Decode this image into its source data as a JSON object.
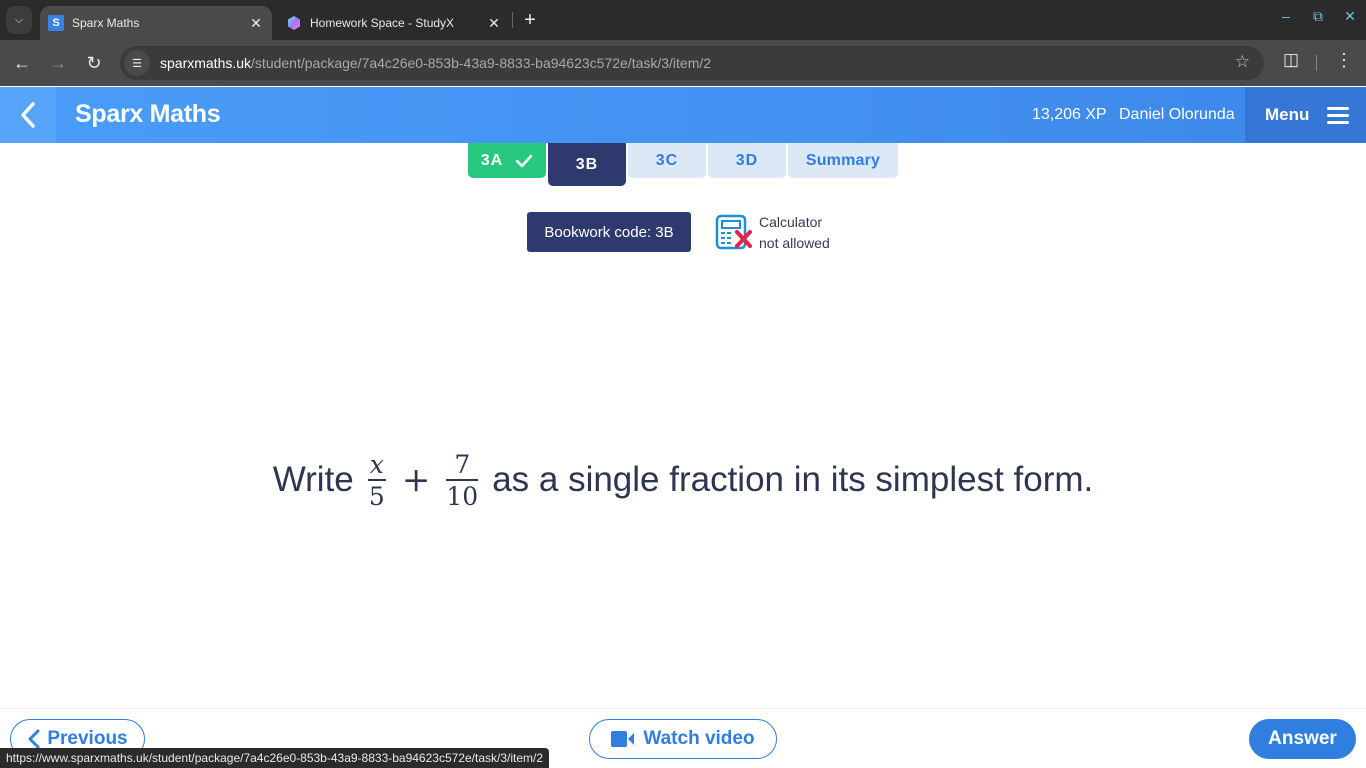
{
  "browser": {
    "tabs": [
      {
        "title": "Sparx Maths",
        "favicon": "S",
        "active": true
      },
      {
        "title": "Homework Space - StudyX",
        "favicon": "studyx-hex",
        "active": false
      }
    ],
    "url_host": "sparxmaths.uk",
    "url_path": "/student/package/7a4c26e0-853b-43a9-8833-ba94623c572e/task/3/item/2",
    "status_url": "https://www.sparxmaths.uk/student/package/7a4c26e0-853b-43a9-8833-ba94623c572e/task/3/item/2",
    "icons": {
      "tab_menu": "chevron-down-icon",
      "back": "arrow-left-icon",
      "forward": "arrow-right-icon",
      "reload": "reload-icon",
      "site_info": "tune-icon",
      "bookmark": "star-icon",
      "extensions": "puzzle-icon",
      "more": "kebab-icon"
    }
  },
  "header": {
    "brand": "Sparx Maths",
    "xp": "13,206 XP",
    "user": "Daniel Olorunda",
    "menu_label": "Menu"
  },
  "task_tabs": [
    {
      "label": "3A",
      "state": "complete"
    },
    {
      "label": "3B",
      "state": "current"
    },
    {
      "label": "3C",
      "state": "todo"
    },
    {
      "label": "3D",
      "state": "todo"
    },
    {
      "label": "Summary",
      "state": "todo"
    }
  ],
  "bookwork": {
    "label": "Bookwork code: 3B",
    "calculator_line1": "Calculator",
    "calculator_line2": "not allowed"
  },
  "question": {
    "prefix": "Write",
    "frac1_num": "x",
    "frac1_den": "5",
    "operator": "+",
    "frac2_num": "7",
    "frac2_den": "10",
    "suffix": "as a single fraction in its simplest form."
  },
  "footer": {
    "previous": "Previous",
    "watch_video": "Watch video",
    "answer": "Answer"
  },
  "colors": {
    "header_blue": "#4b9cf9",
    "complete_green": "#27c77f",
    "current_navy": "#2e3a6e",
    "action_blue": "#2f7ee0",
    "calc_x_red": "#e5244a"
  }
}
